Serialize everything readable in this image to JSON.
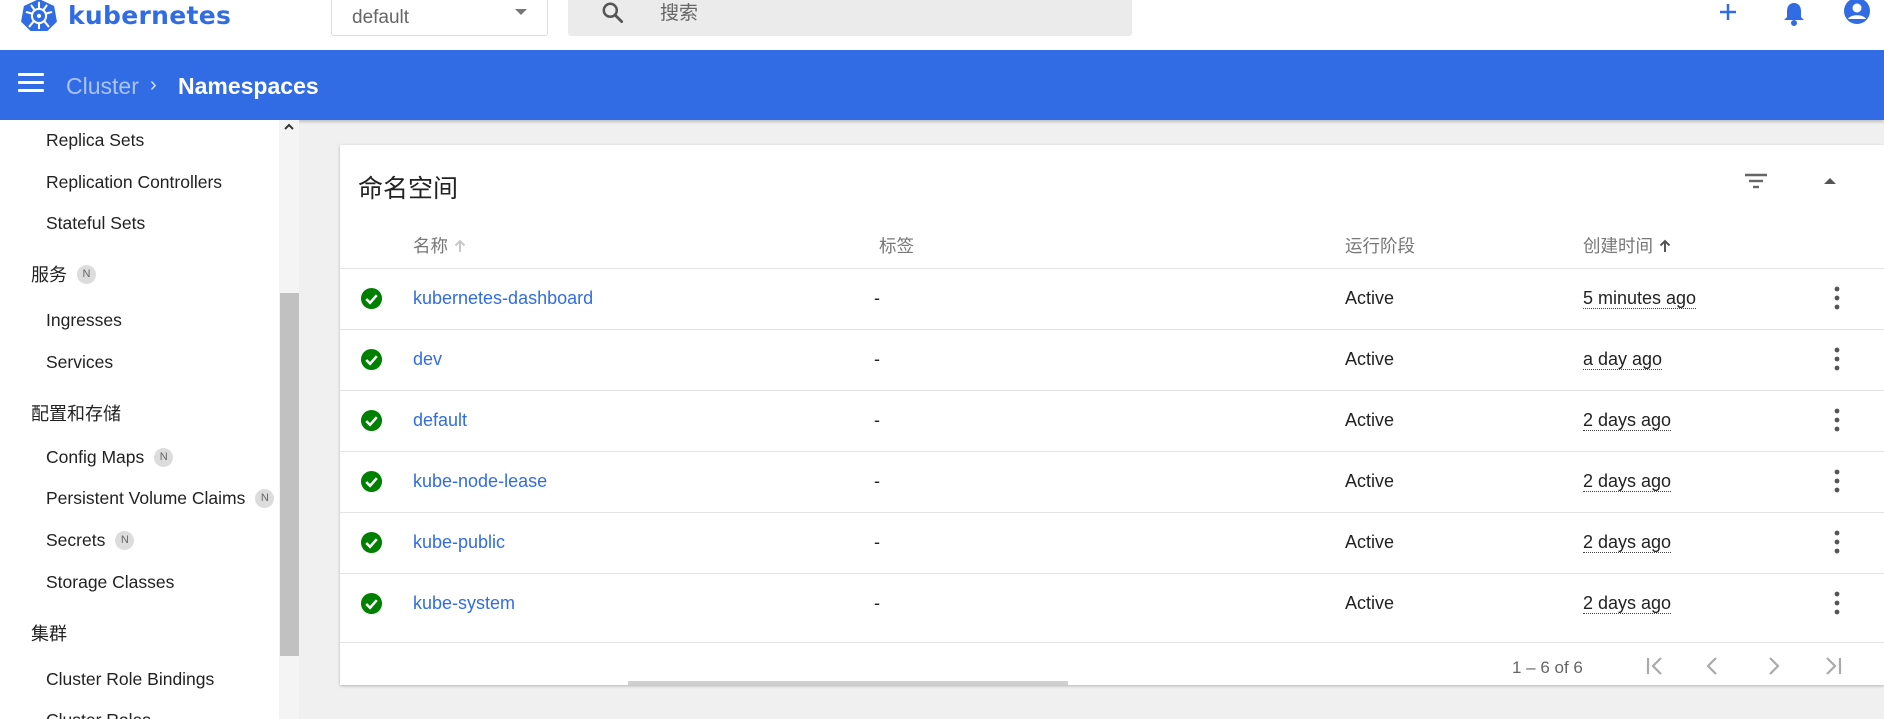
{
  "app": {
    "name": "kubernetes",
    "brand_color": "#326ce5"
  },
  "toolbar": {
    "namespace_selected": "default",
    "search_placeholder": "搜索",
    "actions": [
      "add-icon",
      "notifications-icon",
      "account-icon"
    ]
  },
  "breadcrumb": {
    "parent": "Cluster",
    "current": "Namespaces"
  },
  "sidebar": {
    "items": [
      {
        "type": "item",
        "label": "Replica Sets"
      },
      {
        "type": "item",
        "label": "Replication Controllers"
      },
      {
        "type": "item",
        "label": "Stateful Sets"
      },
      {
        "type": "group",
        "label": "服务",
        "badge": "N"
      },
      {
        "type": "item",
        "label": "Ingresses"
      },
      {
        "type": "item",
        "label": "Services"
      },
      {
        "type": "group",
        "label": "配置和存储"
      },
      {
        "type": "item",
        "label": "Config Maps",
        "badge": "N"
      },
      {
        "type": "item",
        "label": "Persistent Volume Claims",
        "badge": "N"
      },
      {
        "type": "item",
        "label": "Secrets",
        "badge": "N"
      },
      {
        "type": "item",
        "label": "Storage Classes"
      },
      {
        "type": "group",
        "label": "集群"
      },
      {
        "type": "item",
        "label": "Cluster Role Bindings"
      },
      {
        "type": "item",
        "label": "Cluster Roles"
      }
    ]
  },
  "card": {
    "title": "命名空间",
    "columns": {
      "name": "名称",
      "labels": "标签",
      "phase": "运行阶段",
      "created": "创建时间"
    },
    "rows": [
      {
        "name": "kubernetes-dashboard",
        "labels": "-",
        "phase": "Active",
        "created": "5 minutes ago"
      },
      {
        "name": "dev",
        "labels": "-",
        "phase": "Active",
        "created": "a day ago"
      },
      {
        "name": "default",
        "labels": "-",
        "phase": "Active",
        "created": "2 days ago"
      },
      {
        "name": "kube-node-lease",
        "labels": "-",
        "phase": "Active",
        "created": "2 days ago"
      },
      {
        "name": "kube-public",
        "labels": "-",
        "phase": "Active",
        "created": "2 days ago"
      },
      {
        "name": "kube-system",
        "labels": "-",
        "phase": "Active",
        "created": "2 days ago"
      }
    ],
    "pagination": {
      "range": "1 – 6 of 6"
    },
    "status_color": "#008000"
  }
}
